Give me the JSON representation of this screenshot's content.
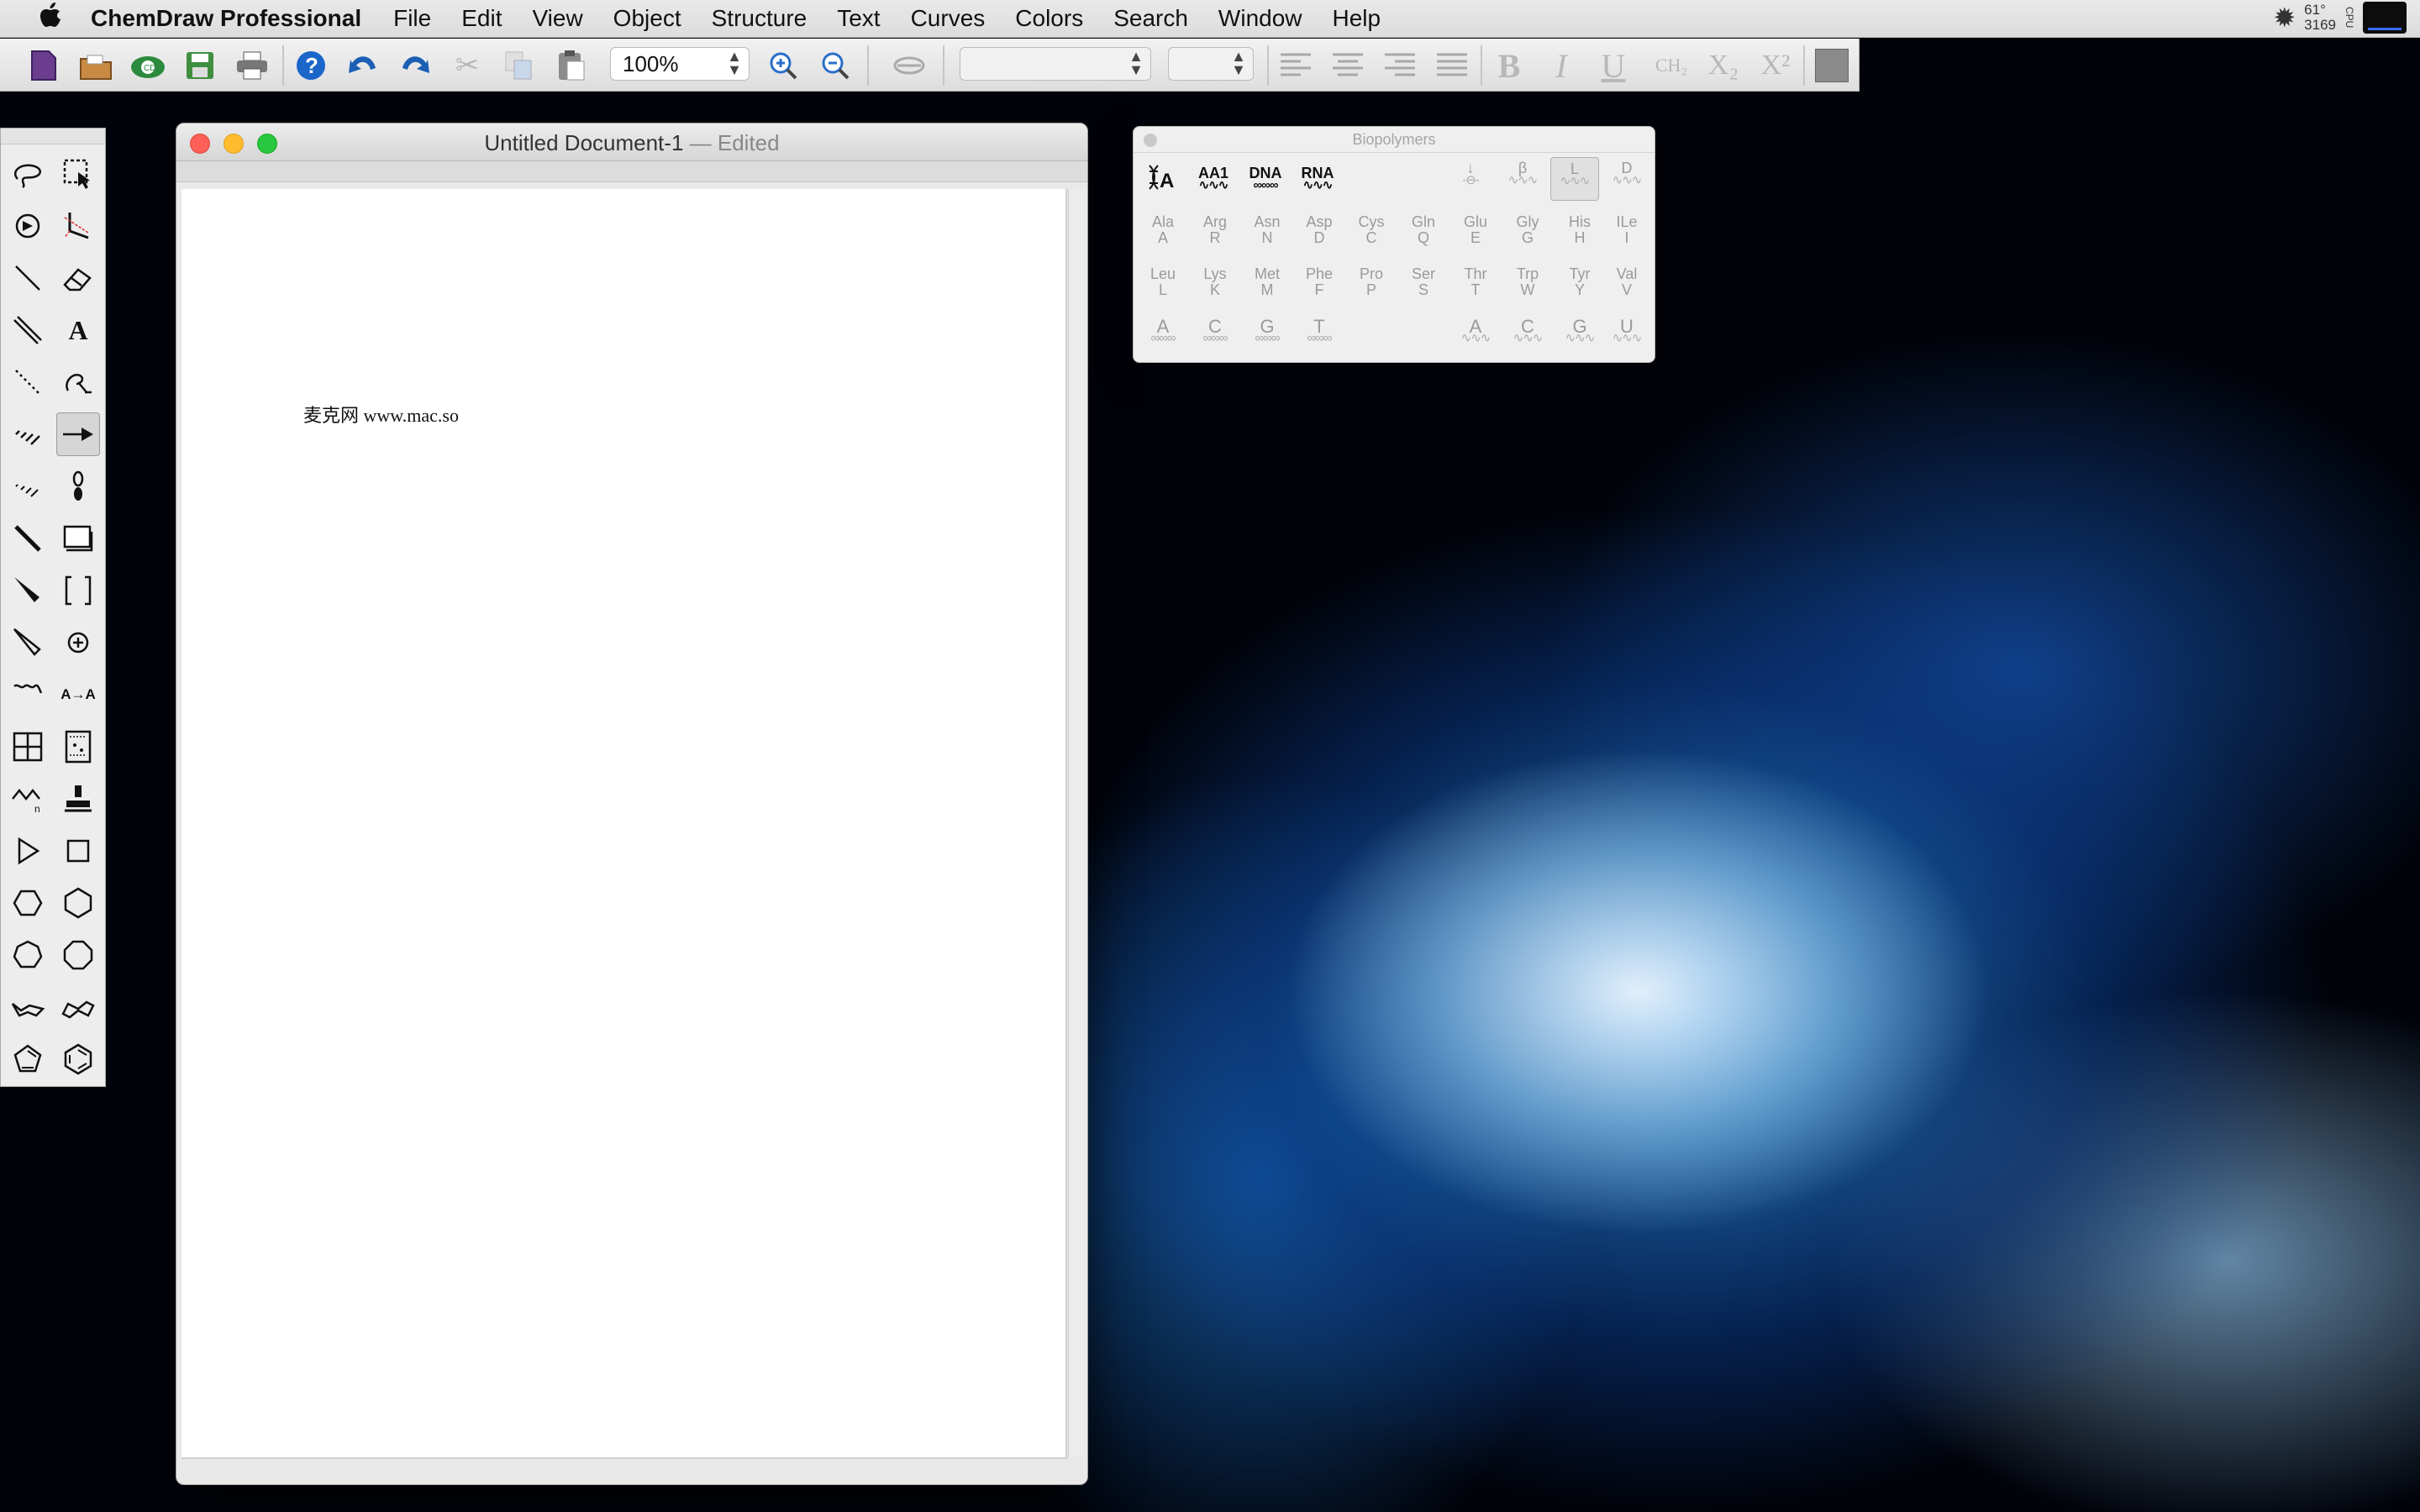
{
  "menubar": {
    "apple": "",
    "app_name": "ChemDraw Professional",
    "items": [
      "File",
      "Edit",
      "View",
      "Object",
      "Structure",
      "Text",
      "Curves",
      "Colors",
      "Search",
      "Window",
      "Help"
    ],
    "status_temp": "61°",
    "status_rpm": "3169",
    "status_cpu": "CPU"
  },
  "toolbar": {
    "zoom_value": "100%",
    "font_field": "",
    "size_field": "",
    "format_labels": {
      "bold": "B",
      "italic": "I",
      "underline": "U",
      "ch2": "CH₂",
      "subscript": "X₂",
      "superscript": "X²"
    }
  },
  "tools": {
    "text_tool": "A",
    "text_format": "A→A"
  },
  "document": {
    "title": "Untitled Document-1",
    "status": " — Edited",
    "content_text": "麦克网 www.mac.so"
  },
  "biopolymers": {
    "title": "Biopolymers",
    "header_buttons": [
      {
        "label": "",
        "icon": "dna-text-icon"
      },
      {
        "label": "AA1"
      },
      {
        "label": "DNA"
      },
      {
        "label": "RNA"
      }
    ],
    "stereo_buttons": [
      {
        "label": "↓"
      },
      {
        "label": "β"
      },
      {
        "label": "L"
      },
      {
        "label": "D"
      }
    ],
    "row1": [
      {
        "name": "Ala",
        "code": "A"
      },
      {
        "name": "Arg",
        "code": "R"
      },
      {
        "name": "Asn",
        "code": "N"
      },
      {
        "name": "Asp",
        "code": "D"
      },
      {
        "name": "Cys",
        "code": "C"
      },
      {
        "name": "Gln",
        "code": "Q"
      },
      {
        "name": "Glu",
        "code": "E"
      },
      {
        "name": "Gly",
        "code": "G"
      },
      {
        "name": "His",
        "code": "H"
      },
      {
        "name": "ILe",
        "code": "I"
      }
    ],
    "row2": [
      {
        "name": "Leu",
        "code": "L"
      },
      {
        "name": "Lys",
        "code": "K"
      },
      {
        "name": "Met",
        "code": "M"
      },
      {
        "name": "Phe",
        "code": "F"
      },
      {
        "name": "Pro",
        "code": "P"
      },
      {
        "name": "Ser",
        "code": "S"
      },
      {
        "name": "Thr",
        "code": "T"
      },
      {
        "name": "Trp",
        "code": "W"
      },
      {
        "name": "Tyr",
        "code": "Y"
      },
      {
        "name": "Val",
        "code": "V"
      }
    ],
    "dna": [
      "A",
      "C",
      "G",
      "T"
    ],
    "rna": [
      "A",
      "C",
      "G",
      "U"
    ]
  },
  "colors": {
    "close": "#fe5f57",
    "minimize": "#febc2e",
    "zoom": "#28c840",
    "help_blue": "#1a66c9",
    "doc_purple": "#6a3d8f",
    "cloud_green": "#2c8a3e"
  }
}
